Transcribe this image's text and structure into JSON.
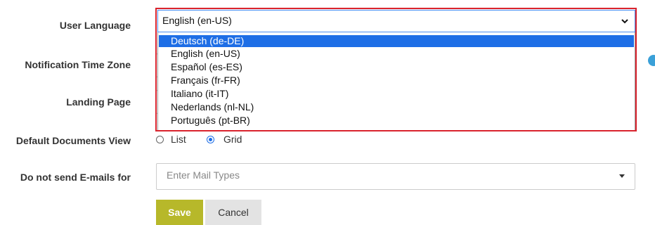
{
  "form": {
    "labels": {
      "user_language": "User Language",
      "notification_time_zone": "Notification Time Zone",
      "landing_page": "Landing Page",
      "default_documents_view": "Default Documents View",
      "do_not_send_emails_for": "Do not send E-mails for"
    },
    "user_language": {
      "selected": "English (en-US)",
      "options": [
        "Deutsch (de-DE)",
        "English (en-US)",
        "Español (es-ES)",
        "Français (fr-FR)",
        "Italiano (it-IT)",
        "Nederlands (nl-NL)",
        "Português (pt-BR)"
      ],
      "highlighted_option": "Deutsch (de-DE)"
    },
    "documents_view": {
      "options": [
        "List",
        "Grid"
      ],
      "selected": "Grid"
    },
    "mail_types": {
      "placeholder": "Enter Mail Types"
    },
    "buttons": {
      "save": "Save",
      "cancel": "Cancel"
    }
  },
  "colors": {
    "save_button": "#b7b82a",
    "cancel_button": "#e3e3e3",
    "highlight_option": "#1e6ee6",
    "annotation_frame": "#d9232d",
    "info_dot": "#3aa0d8"
  },
  "icons": [
    "chevron-down-icon",
    "caret-down-icon",
    "info-icon"
  ]
}
